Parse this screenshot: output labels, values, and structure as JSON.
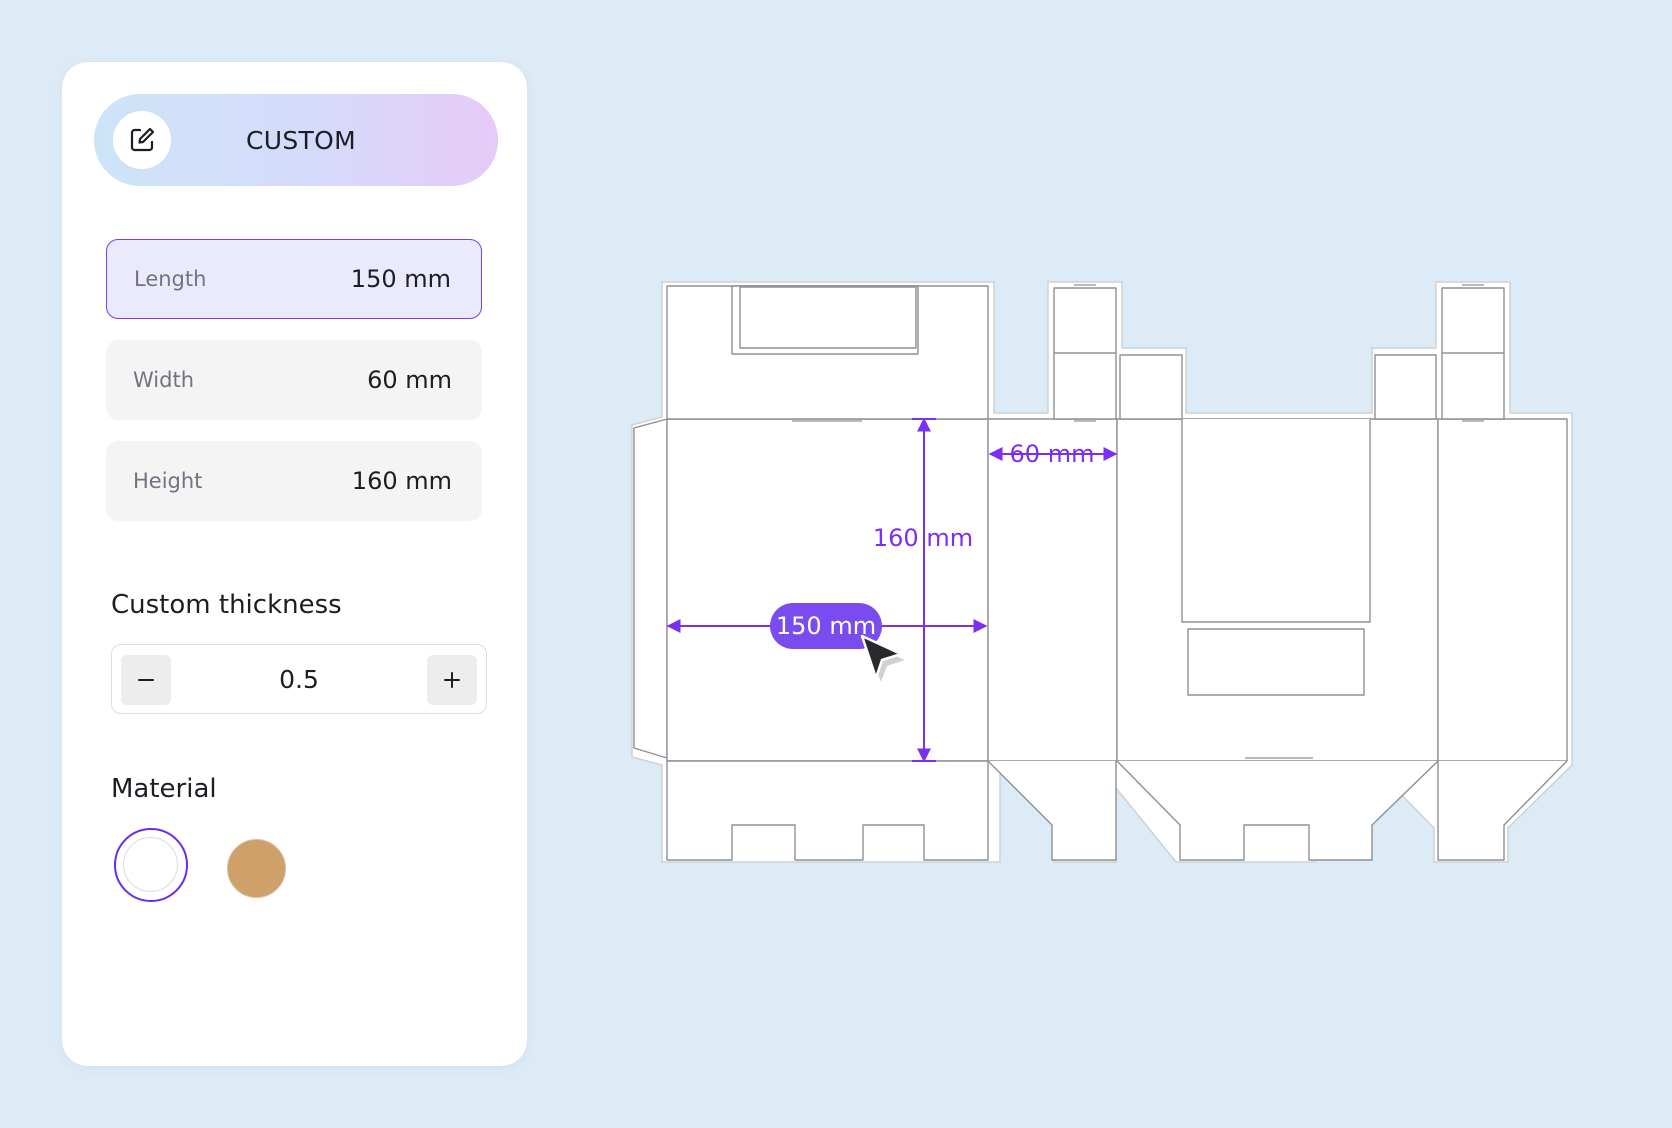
{
  "mode": {
    "label": "CUSTOM",
    "icon": "edit-icon"
  },
  "dimensions": [
    {
      "name": "Length",
      "value": "150 mm",
      "active": true
    },
    {
      "name": "Width",
      "value": "60 mm",
      "active": false
    },
    {
      "name": "Height",
      "value": "160 mm",
      "active": false
    }
  ],
  "thickness": {
    "title": "Custom thickness",
    "value": "0.5",
    "minus_label": "−",
    "plus_label": "+"
  },
  "material": {
    "title": "Material",
    "options": [
      {
        "name": "white",
        "color": "#ffffff",
        "selected": true
      },
      {
        "name": "kraft",
        "color": "#cfa06a",
        "selected": false
      }
    ]
  },
  "dieline": {
    "width_label": "60 mm",
    "height_label": "160 mm",
    "length_label": "150 mm",
    "accent_color": "#7b2ff0",
    "chip_color": "#7a4cf0"
  }
}
